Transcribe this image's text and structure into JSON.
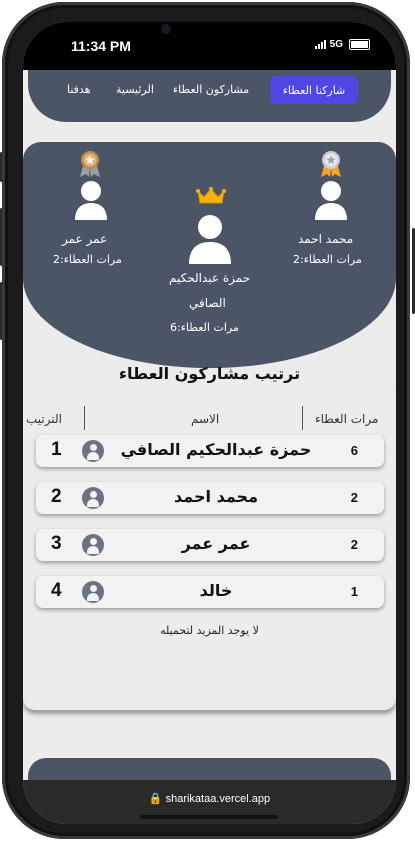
{
  "status": {
    "time": "11:34 PM",
    "network": "5G"
  },
  "nav": {
    "active": "شاركنا العطاء",
    "items": [
      "مشاركون العطاء",
      "الرئيسية",
      "هدفنا"
    ]
  },
  "podium": {
    "first": {
      "name_line1": "حمزة عبدالحكيم",
      "name_line2": "الصافي",
      "count": "مرات العطاء:6"
    },
    "second": {
      "name": "محمد احمد",
      "count": "مرات العطاء:2"
    },
    "third": {
      "name": "عمر عمر",
      "count": "مرات العطاء:2"
    }
  },
  "ranking": {
    "title": "ترتيب مشاركون العطاء",
    "headers": {
      "count": "مرات العطاء",
      "name": "الاسم",
      "rank": "الترتيب"
    },
    "rows": [
      {
        "rank": "1",
        "name": "حمزة عبدالحكيم الصافي",
        "count": "6"
      },
      {
        "rank": "2",
        "name": "محمد احمد",
        "count": "2"
      },
      {
        "rank": "3",
        "name": "عمر عمر",
        "count": "2"
      },
      {
        "rank": "4",
        "name": "خالد",
        "count": "1"
      }
    ],
    "no_more": "لا يوجد المزيد لتحميله"
  },
  "browser": {
    "url": "sharikataa.vercel.app"
  },
  "colors": {
    "panel": "#4b5565",
    "accent": "#4f46e5",
    "crown": "#f5b400"
  }
}
